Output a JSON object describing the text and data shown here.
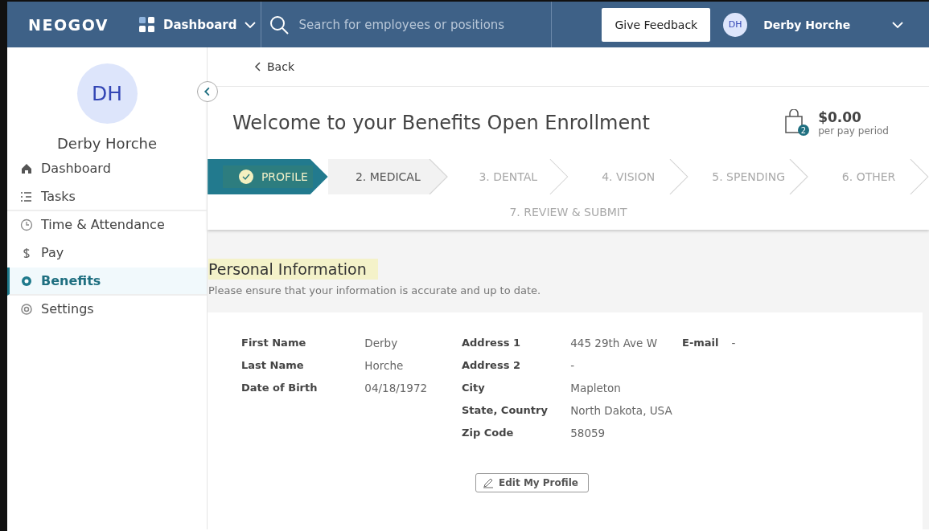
{
  "header": {
    "logo": "NEOGOV",
    "app_menu": "Dashboard",
    "search": {
      "placeholder": "Search for employees or positions"
    },
    "feedback_button": "Give Feedback",
    "user": {
      "initials": "DH",
      "name": "Derby Horche"
    }
  },
  "sidebar": {
    "avatar": "DH",
    "name": "Derby Horche",
    "items": [
      {
        "label": "Dashboard",
        "selected": false
      },
      {
        "label": "Tasks",
        "selected": false
      },
      {
        "label": "Time & Attendance",
        "selected": false
      },
      {
        "label": "Pay",
        "selected": false
      },
      {
        "label": "Benefits",
        "selected": true
      },
      {
        "label": "Settings",
        "selected": false
      }
    ]
  },
  "back_link": "Back",
  "title": "Welcome to your Benefits Open Enrollment",
  "cart": {
    "count": "2",
    "amount": "$0.00",
    "caption": "per pay period"
  },
  "steps": [
    {
      "label": "PROFILE",
      "completed": true,
      "selected": false
    },
    {
      "label": "2. MEDICAL",
      "completed": false,
      "selected": true
    },
    {
      "label": "3. DENTAL",
      "completed": false,
      "selected": false
    },
    {
      "label": "4. VISION",
      "completed": false,
      "selected": false
    },
    {
      "label": "5. SPENDING",
      "completed": false,
      "selected": false
    },
    {
      "label": "6. OTHER",
      "completed": false,
      "selected": false
    },
    {
      "label": "7. REVIEW & SUBMIT",
      "completed": false,
      "selected": false
    }
  ],
  "section": {
    "title": "Personal Information",
    "subtitle": "Please ensure that your information is accurate and up to date."
  },
  "fields": [
    [
      {
        "label": "First Name",
        "value": "Derby"
      },
      {
        "label": "Last Name",
        "value": "Horche"
      },
      {
        "label": "Date of Birth",
        "value": "04/18/1972"
      }
    ],
    [
      {
        "label": "Address 1",
        "value": "445 29th Ave W"
      },
      {
        "label": "Address 2",
        "value": "-"
      },
      {
        "label": "City",
        "value": "Mapleton"
      },
      {
        "label": "State, Country",
        "value": "North Dakota, USA"
      },
      {
        "label": "Zip Code",
        "value": "58059"
      }
    ],
    [
      {
        "label": "E-mail",
        "value": "-"
      }
    ]
  ],
  "edit_button": "Edit My Profile"
}
